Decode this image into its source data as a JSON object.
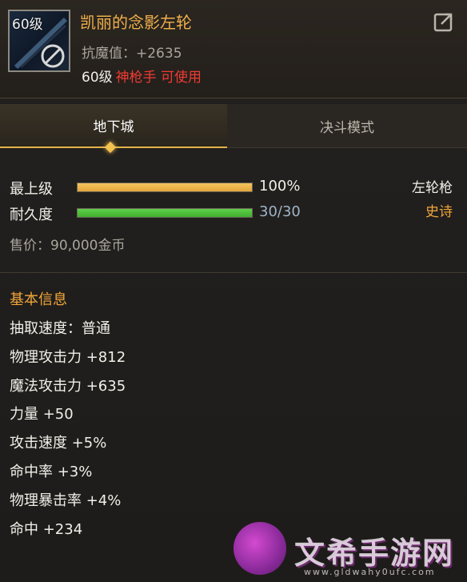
{
  "item": {
    "icon_level": "60级",
    "name": "凯丽的念影左轮",
    "stat_line": "抗魔值：+2635",
    "req_level": "60级",
    "req_class": "神枪手 可使用"
  },
  "tabs": [
    {
      "label": "地下城",
      "active": true
    },
    {
      "label": "决斗模式",
      "active": false
    }
  ],
  "bars": {
    "level": {
      "label": "最上级",
      "value": "100%",
      "fraction": 1.0,
      "color": "#e4a63a"
    },
    "durability": {
      "label": "耐久度",
      "value": "30/30",
      "fraction": 1.0,
      "color": "#3fae2d",
      "value_color": "#9fb3c6"
    }
  },
  "weapon_type": "左轮枪",
  "rarity": "史诗",
  "price": "售价：90,000金币",
  "basic_info": {
    "title": "基本信息",
    "attributes": [
      "抽取速度：普通",
      "物理攻击力 +812",
      "魔法攻击力 +635",
      "力量 +50",
      "攻击速度 +5%",
      "命中率 +3%",
      "物理暴击率 +4%",
      "命中 +234"
    ]
  },
  "watermark": {
    "text": "文希手游网",
    "url": "www.gldwahy0ufc.com"
  }
}
